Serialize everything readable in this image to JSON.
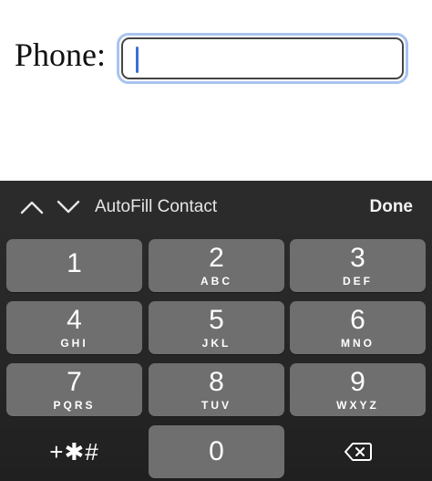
{
  "form": {
    "label": "Phone:",
    "input_value": "",
    "input_placeholder": ""
  },
  "accessory": {
    "autofill_label": "AutoFill Contact",
    "done_label": "Done",
    "prev_icon": "chevron-up-icon",
    "next_icon": "chevron-down-icon"
  },
  "keypad": {
    "keys": [
      {
        "digit": "1",
        "letters": ""
      },
      {
        "digit": "2",
        "letters": "ABC"
      },
      {
        "digit": "3",
        "letters": "DEF"
      },
      {
        "digit": "4",
        "letters": "GHI"
      },
      {
        "digit": "5",
        "letters": "JKL"
      },
      {
        "digit": "6",
        "letters": "MNO"
      },
      {
        "digit": "7",
        "letters": "PQRS"
      },
      {
        "digit": "8",
        "letters": "TUV"
      },
      {
        "digit": "9",
        "letters": "WXYZ"
      },
      {
        "digit": "0",
        "letters": ""
      }
    ],
    "symbols_label": "+✱#",
    "delete_icon": "backspace-icon"
  },
  "colors": {
    "focus_ring": "#a9c3ee",
    "caret": "#3b6fd9",
    "keyboard_bg": "#262626",
    "key_bg": "#6f6f6f"
  }
}
